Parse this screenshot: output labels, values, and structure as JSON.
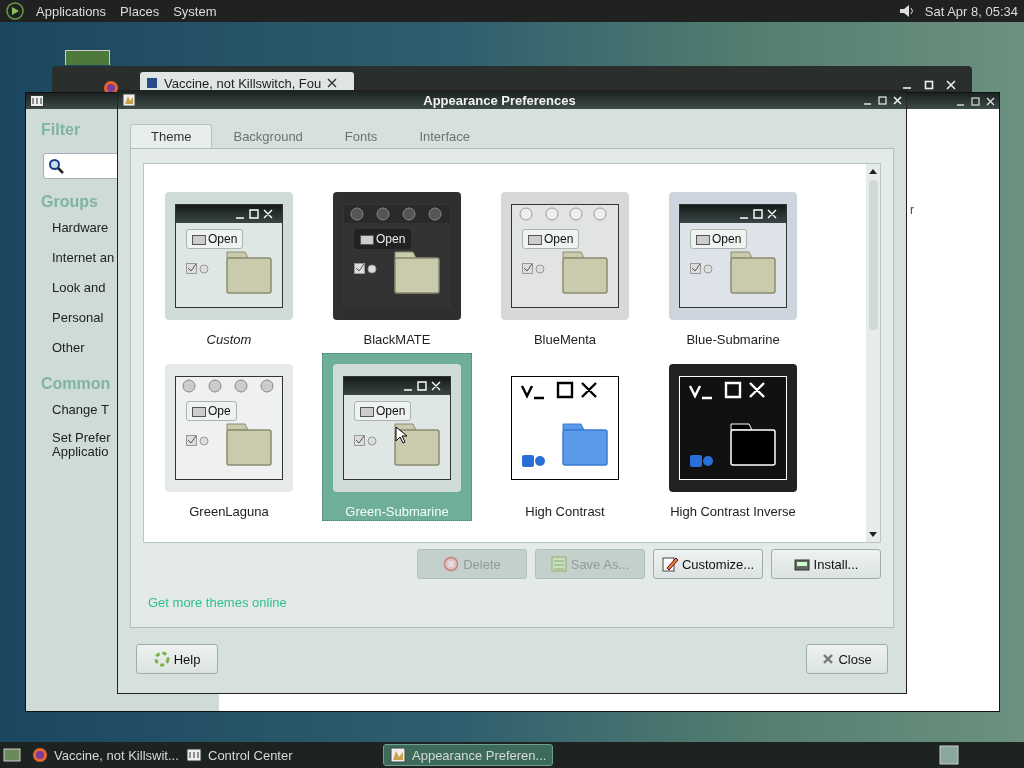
{
  "top_panel": {
    "menus": [
      "Applications",
      "Places",
      "System"
    ],
    "clock": "Sat Apr 8, 05:34"
  },
  "browser_window": {
    "tab_title": "Vaccine, not Killswitch, Fou"
  },
  "control_center": {
    "filter_heading": "Filter",
    "groups_heading": "Groups",
    "groups": [
      "Hardware",
      "Internet an",
      "Look and",
      "Personal",
      "Other"
    ],
    "common_heading": "Common",
    "common_tasks": [
      "Change T",
      "Set Prefer\nApplicatio"
    ],
    "content_fragment": "r"
  },
  "dialog": {
    "title": "Appearance Preferences",
    "tabs": [
      {
        "label": "Theme",
        "selected": true
      },
      {
        "label": "Background",
        "selected": false
      },
      {
        "label": "Fonts",
        "selected": false
      },
      {
        "label": "Interface",
        "selected": false
      }
    ],
    "themes": [
      {
        "name": "Custom",
        "kind": "light",
        "custom": true,
        "selected": false,
        "open_label": "Open"
      },
      {
        "name": "BlackMATE",
        "kind": "dark",
        "custom": false,
        "selected": false,
        "open_label": "Open"
      },
      {
        "name": "BlueMenta",
        "kind": "gray",
        "custom": false,
        "selected": false,
        "open_label": "Open"
      },
      {
        "name": "Blue-Submarine",
        "kind": "blue",
        "custom": false,
        "selected": false,
        "open_label": "Open"
      },
      {
        "name": "GreenLaguna",
        "kind": "laguna",
        "custom": false,
        "selected": false,
        "open_label": "Ope"
      },
      {
        "name": "Green-Submarine",
        "kind": "light",
        "custom": false,
        "selected": true,
        "open_label": "Open"
      },
      {
        "name": "High Contrast",
        "kind": "contrast",
        "custom": false,
        "selected": false
      },
      {
        "name": "High Contrast Inverse",
        "kind": "inverse",
        "custom": false,
        "selected": false
      }
    ],
    "actions": [
      {
        "label": "Delete",
        "kind": "delete",
        "disabled": true
      },
      {
        "label": "Save As...",
        "kind": "save",
        "disabled": true
      },
      {
        "label": "Customize...",
        "kind": "customize",
        "disabled": false
      },
      {
        "label": "Install...",
        "kind": "install",
        "disabled": false
      }
    ],
    "link": "Get more themes online",
    "help": "Help",
    "close": "Close"
  },
  "taskbar": {
    "items": [
      {
        "label": "Vaccine, not Killswit...",
        "kind": "browser",
        "selected": false
      },
      {
        "label": "Control Center",
        "kind": "control",
        "selected": false
      },
      {
        "label": "Appearance Preferen...",
        "kind": "appearance",
        "selected": true
      }
    ]
  }
}
